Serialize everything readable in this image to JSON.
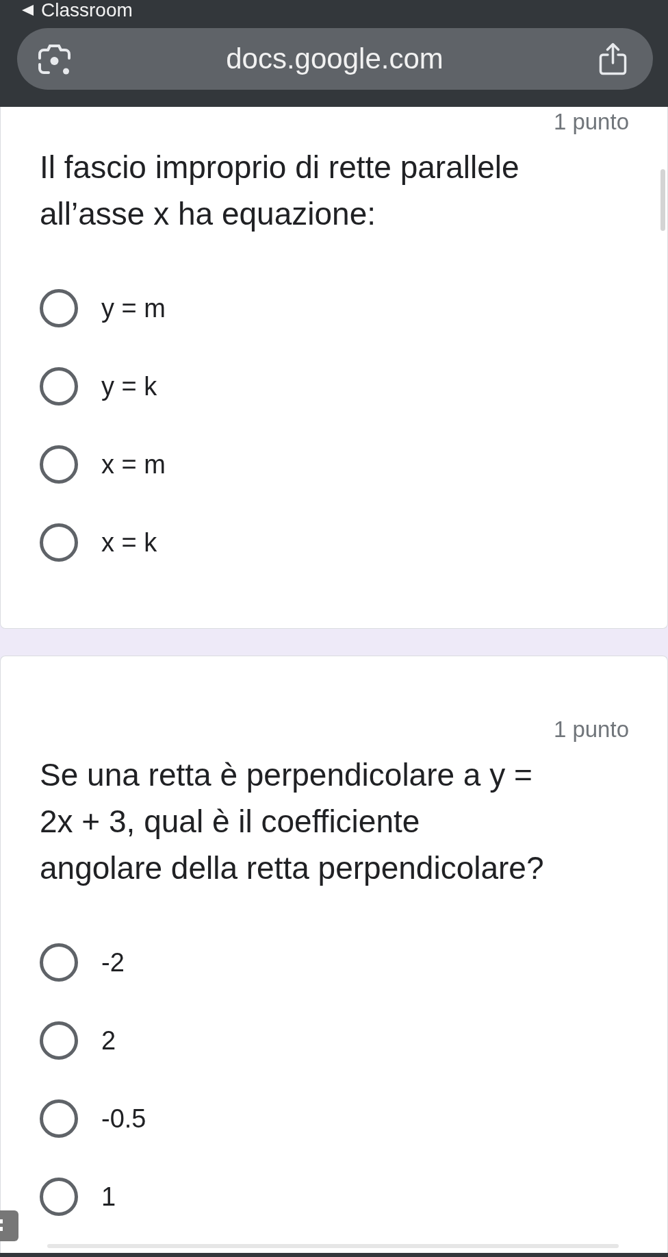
{
  "browser": {
    "back_label": "Classroom",
    "url": "docs.google.com"
  },
  "questions": [
    {
      "points": "1 punto",
      "text_lines": [
        "Il fascio improprio di rette parallele",
        "all’asse x ha equazione:"
      ],
      "options": [
        {
          "label": "y = m",
          "selected": false
        },
        {
          "label": "y = k",
          "selected": false
        },
        {
          "label": "x = m",
          "selected": false
        },
        {
          "label": "x = k",
          "selected": false
        }
      ]
    },
    {
      "points": "1 punto",
      "text_lines": [
        "Se una retta è perpendicolare a y =",
        "2x + 3, qual è il coefficiente",
        "angolare della retta perpendicolare?"
      ],
      "options": [
        {
          "label": "-2",
          "selected": false
        },
        {
          "label": "2",
          "selected": false
        },
        {
          "label": "-0.5",
          "selected": false
        },
        {
          "label": "1",
          "selected": false
        }
      ]
    }
  ]
}
